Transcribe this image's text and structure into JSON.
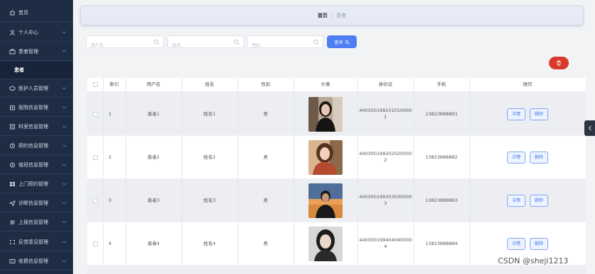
{
  "sidebar": {
    "items": [
      {
        "label": "首页",
        "icon": "home-icon",
        "expandable": false
      },
      {
        "label": "个人中心",
        "icon": "user-icon",
        "expandable": true
      },
      {
        "label": "患者管理",
        "icon": "patient-icon",
        "expandable": true,
        "expanded": true
      },
      {
        "label": "患者",
        "icon": "",
        "expandable": false,
        "sub": true,
        "active": true
      },
      {
        "label": "医护人员管理",
        "icon": "medical-staff-icon",
        "expandable": true
      },
      {
        "label": "医院信息管理",
        "icon": "hospital-icon",
        "expandable": true
      },
      {
        "label": "科室信息管理",
        "icon": "department-icon",
        "expandable": true
      },
      {
        "label": "预约信息管理",
        "icon": "clock-icon",
        "expandable": true
      },
      {
        "label": "值班信息管理",
        "icon": "duty-icon",
        "expandable": true
      },
      {
        "label": "上门预约管理",
        "icon": "grid-icon",
        "expandable": true
      },
      {
        "label": "诊断信息管理",
        "icon": "send-icon",
        "expandable": true
      },
      {
        "label": "上报信息管理",
        "icon": "list-icon",
        "expandable": true
      },
      {
        "label": "反馈意见管理",
        "icon": "feedback-icon",
        "expandable": true
      },
      {
        "label": "收费信息管理",
        "icon": "fee-icon",
        "expandable": true
      }
    ]
  },
  "breadcrumb": {
    "home": "首页",
    "separator": "/",
    "current": "患者"
  },
  "search": {
    "username_placeholder": "用户名",
    "name_placeholder": "姓名",
    "gender_placeholder": "性别",
    "query_label": "查询"
  },
  "table": {
    "headers": [
      "索引",
      "用户名",
      "姓名",
      "性别",
      "头像",
      "身份证",
      "手机",
      "操作"
    ],
    "rows": [
      {
        "index": "1",
        "username": "患者1",
        "name": "姓名1",
        "gender": "男",
        "id_card_line1": "440300199101010000",
        "id_card_line2": "1",
        "phone": "13823888881",
        "detail": "详情",
        "delete": "删除"
      },
      {
        "index": "2",
        "username": "患者2",
        "name": "姓名2",
        "gender": "男",
        "id_card_line1": "440300199202020000",
        "id_card_line2": "2",
        "phone": "13823888882",
        "detail": "详情",
        "delete": "删除"
      },
      {
        "index": "3",
        "username": "患者3",
        "name": "姓名3",
        "gender": "男",
        "id_card_line1": "440300199303030000",
        "id_card_line2": "3",
        "phone": "13823888883",
        "detail": "详情",
        "delete": "删除"
      },
      {
        "index": "4",
        "username": "患者4",
        "name": "姓名4",
        "gender": "男",
        "id_card_line1": "440300199404040000",
        "id_card_line2": "4",
        "phone": "13823888884",
        "detail": "详情",
        "delete": "删除"
      }
    ]
  },
  "watermark": "CSDN @sheji1213",
  "colors": {
    "sidebar_bg": "#1f2d44",
    "primary": "#4d7ef4",
    "danger": "#d93a2c",
    "row_bg": "#eceef2"
  }
}
